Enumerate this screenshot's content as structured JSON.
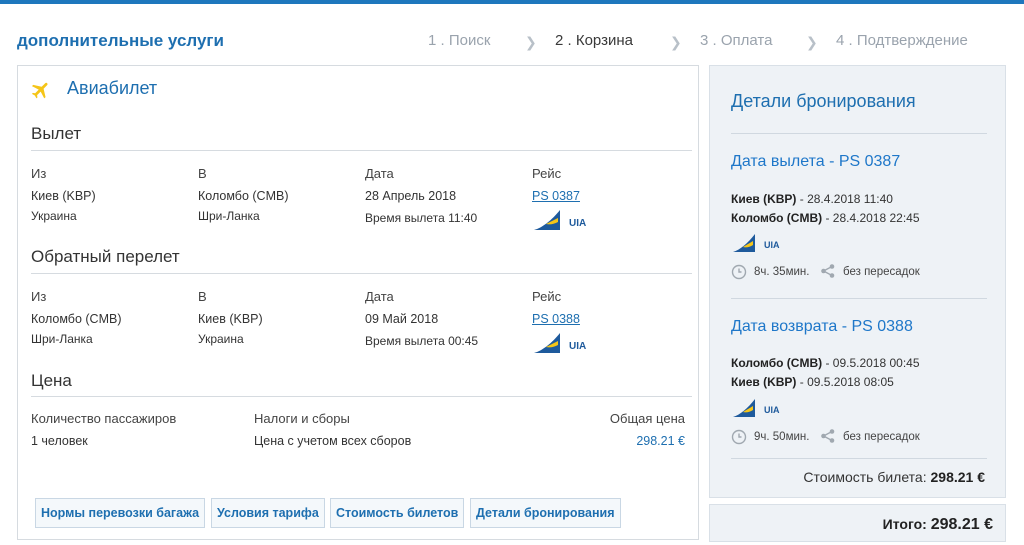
{
  "header": {
    "title": "дополнительные услуги",
    "steps": [
      "1 . Поиск",
      "2 . Корзина",
      "3 . Оплата",
      "4 . Подтверждение"
    ],
    "active_step": 1
  },
  "main": {
    "title": "Авиабилет",
    "columns": {
      "from": "Из",
      "to": "В",
      "date": "Дата",
      "flight": "Рейс"
    },
    "outbound": {
      "section": "Вылет",
      "from_city": "Киев (KBP)",
      "from_country": "Украина",
      "to_city": "Коломбо (CMB)",
      "to_country": "Шри-Ланка",
      "date": "28 Апрель 2018",
      "departure": "Время вылета 11:40",
      "flight": "PS 0387",
      "airline": "UIA"
    },
    "return": {
      "section": "Обратный перелет",
      "from_city": "Коломбо (CMB)",
      "from_country": "Шри-Ланка",
      "to_city": "Киев (KBP)",
      "to_country": "Украина",
      "date": "09 Май 2018",
      "departure": "Время вылета 00:45",
      "flight": "PS 0388",
      "airline": "UIA"
    },
    "price": {
      "section": "Цена",
      "passengers_label": "Количество пассажиров",
      "passengers_value": "1 человек",
      "taxes_label": "Налоги и сборы",
      "taxes_value": "Цена с учетом всех сборов",
      "total_label": "Общая цена",
      "total_value": "298.21 €"
    },
    "buttons": {
      "baggage": "Нормы перевозки багажа",
      "tariff": "Условия тарифа",
      "cost": "Стоимость билетов",
      "details": "Детали бронирования"
    }
  },
  "sidebar": {
    "title": "Детали бронирования",
    "outbound": {
      "title": "Дата вылета - PS 0387",
      "line1_city": "Киев (KBP)",
      "line1_time": " - 28.4.2018 11:40",
      "line2_city": "Коломбо (CMB)",
      "line2_time": " - 28.4.2018 22:45",
      "airline": "UIA",
      "duration": "8ч. 35мин.",
      "stops": "без пересадок"
    },
    "return": {
      "title": "Дата возврата - PS 0388",
      "line1_city": "Коломбо (CMB)",
      "line1_time": " - 09.5.2018 00:45",
      "line2_city": "Киев (KBP)",
      "line2_time": " - 09.5.2018 08:05",
      "airline": "UIA",
      "duration": "9ч. 50мин.",
      "stops": "без пересадок"
    },
    "ticket_cost_label": "Стоимость билета: ",
    "ticket_cost_value": "298.21 €",
    "total_label": "Итого: ",
    "total_value": "298.21 €"
  },
  "colors": {
    "accent": "#1e6fb0",
    "topbar": "#1e77bd",
    "plane_icon": "#f5c518",
    "airline_blue": "#1e5a9c",
    "airline_yellow": "#f5c518"
  }
}
